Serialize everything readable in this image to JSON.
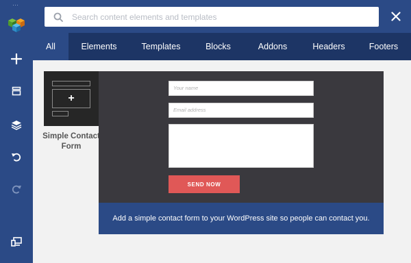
{
  "sidebar": {
    "logo_icon": "cube-logo-icon",
    "items": [
      {
        "name": "add-element-button",
        "icon": "plus-icon"
      },
      {
        "name": "layout-button",
        "icon": "layout-icon"
      },
      {
        "name": "layers-button",
        "icon": "layers-icon"
      },
      {
        "name": "undo-button",
        "icon": "undo-icon"
      },
      {
        "name": "redo-button",
        "icon": "redo-icon",
        "disabled": true
      },
      {
        "name": "responsive-button",
        "icon": "devices-icon"
      }
    ]
  },
  "search": {
    "placeholder": "Search content elements and templates",
    "value": ""
  },
  "tabs": [
    {
      "label": "All",
      "active": true
    },
    {
      "label": "Elements",
      "active": false
    },
    {
      "label": "Templates",
      "active": false
    },
    {
      "label": "Blocks",
      "active": false
    },
    {
      "label": "Addons",
      "active": false
    },
    {
      "label": "Headers",
      "active": false
    },
    {
      "label": "Footers",
      "active": false
    }
  ],
  "elements": [
    {
      "title": "Simple Contact Form",
      "icon": "plus-icon"
    }
  ],
  "preview": {
    "form": {
      "name_placeholder": "Your name",
      "email_placeholder": "Email address",
      "send_label": "SEND NOW"
    },
    "description": "Add a simple contact form to your WordPress site so people can contact you."
  },
  "colors": {
    "sidebar": "#2b4a86",
    "tabbar": "#1d3565",
    "preview_bg": "#3a393e",
    "send_button": "#e05857"
  }
}
